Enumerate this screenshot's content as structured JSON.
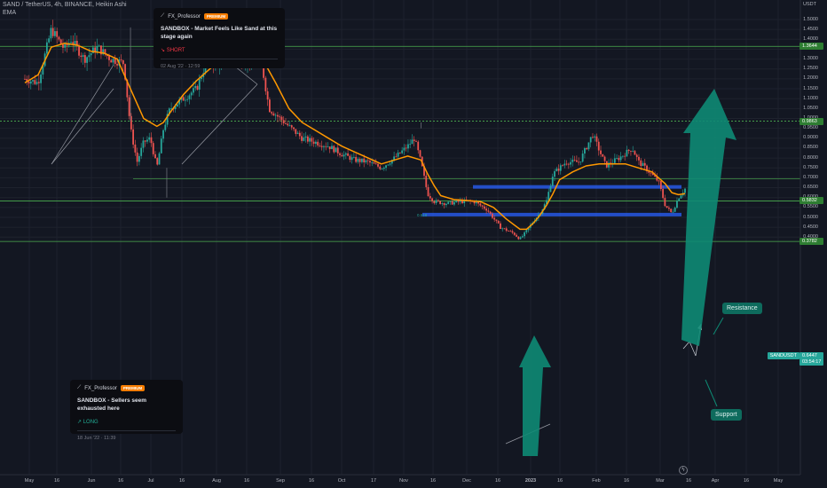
{
  "header": {
    "symbol_line": "SAND / TetherUS, 4h, BINANCE, Heikin Ashi",
    "indicator": "EMA"
  },
  "price_axis": {
    "currency": "USDT"
  },
  "chart_data": {
    "type": "candlestick",
    "symbol": "SAND / TetherUS",
    "interval": "4h",
    "exchange": "BINANCE",
    "candle_style": "Heikin Ashi",
    "y_ticks": [
      "1.5000",
      "1.4500",
      "1.4000",
      "1.3500",
      "1.3000",
      "1.2500",
      "1.2000",
      "1.1500",
      "1.1000",
      "1.0500",
      "1.0000",
      "0.9500",
      "0.9000",
      "0.8500",
      "0.8000",
      "0.7500",
      "0.7000",
      "0.6500",
      "0.6000",
      "0.5500",
      "0.5000",
      "0.4500",
      "0.4000"
    ],
    "x_ticks": [
      "May",
      "16",
      "Jun",
      "16",
      "Jul",
      "16",
      "Aug",
      "16",
      "Sep",
      "16",
      "Oct",
      "17",
      "Nov",
      "16",
      "Dec",
      "16",
      "2023",
      "16",
      "Feb",
      "16",
      "Mar",
      "16",
      "Apr",
      "16",
      "May"
    ],
    "ylim": [
      0.39,
      1.56
    ],
    "price_path": [
      [
        0,
        1.2
      ],
      [
        2,
        1.18
      ],
      [
        4,
        1.45
      ],
      [
        6,
        1.35
      ],
      [
        7,
        1.4
      ],
      [
        9,
        1.3
      ],
      [
        11,
        1.36
      ],
      [
        13,
        1.3
      ],
      [
        15,
        1.28
      ],
      [
        16,
        0.95
      ],
      [
        17,
        0.78
      ],
      [
        18,
        0.88
      ],
      [
        19,
        0.9
      ],
      [
        20,
        0.75
      ],
      [
        21,
        0.95
      ],
      [
        22,
        1.05
      ],
      [
        24,
        1.1
      ],
      [
        26,
        1.15
      ],
      [
        28,
        1.33
      ],
      [
        29,
        1.24
      ],
      [
        31,
        1.4
      ],
      [
        33,
        1.28
      ],
      [
        35,
        1.3
      ],
      [
        36,
        1.25
      ],
      [
        37,
        1.05
      ],
      [
        38,
        1.02
      ],
      [
        40,
        0.96
      ],
      [
        42,
        0.9
      ],
      [
        44,
        0.88
      ],
      [
        46,
        0.86
      ],
      [
        48,
        0.82
      ],
      [
        50,
        0.79
      ],
      [
        52,
        0.78
      ],
      [
        54,
        0.75
      ],
      [
        56,
        0.8
      ],
      [
        58,
        0.86
      ],
      [
        59,
        0.9
      ],
      [
        60,
        0.78
      ],
      [
        61,
        0.62
      ],
      [
        62,
        0.58
      ],
      [
        64,
        0.57
      ],
      [
        66,
        0.58
      ],
      [
        68,
        0.58
      ],
      [
        70,
        0.54
      ],
      [
        72,
        0.45
      ],
      [
        74,
        0.42
      ],
      [
        75,
        0.39
      ],
      [
        76,
        0.43
      ],
      [
        77,
        0.48
      ],
      [
        78,
        0.52
      ],
      [
        79,
        0.58
      ],
      [
        80,
        0.72
      ],
      [
        82,
        0.78
      ],
      [
        84,
        0.78
      ],
      [
        86,
        0.92
      ],
      [
        88,
        0.76
      ],
      [
        90,
        0.8
      ],
      [
        92,
        0.85
      ],
      [
        93,
        0.78
      ],
      [
        94,
        0.75
      ],
      [
        96,
        0.68
      ],
      [
        97,
        0.56
      ],
      [
        98,
        0.52
      ],
      [
        99,
        0.6
      ],
      [
        100,
        0.6447
      ]
    ],
    "ema_path": [
      [
        0,
        1.18
      ],
      [
        2,
        1.22
      ],
      [
        4,
        1.36
      ],
      [
        6,
        1.38
      ],
      [
        8,
        1.37
      ],
      [
        10,
        1.34
      ],
      [
        12,
        1.33
      ],
      [
        14,
        1.3
      ],
      [
        16,
        1.15
      ],
      [
        18,
        1.0
      ],
      [
        20,
        0.96
      ],
      [
        21,
        0.98
      ],
      [
        22,
        1.03
      ],
      [
        24,
        1.12
      ],
      [
        26,
        1.19
      ],
      [
        28,
        1.25
      ],
      [
        30,
        1.3
      ],
      [
        32,
        1.32
      ],
      [
        34,
        1.33
      ],
      [
        36,
        1.3
      ],
      [
        38,
        1.18
      ],
      [
        40,
        1.05
      ],
      [
        42,
        0.98
      ],
      [
        44,
        0.94
      ],
      [
        46,
        0.9
      ],
      [
        48,
        0.86
      ],
      [
        50,
        0.83
      ],
      [
        52,
        0.8
      ],
      [
        54,
        0.77
      ],
      [
        56,
        0.79
      ],
      [
        58,
        0.81
      ],
      [
        60,
        0.79
      ],
      [
        61,
        0.72
      ],
      [
        62,
        0.66
      ],
      [
        63,
        0.61
      ],
      [
        65,
        0.59
      ],
      [
        67,
        0.585
      ],
      [
        69,
        0.58
      ],
      [
        71,
        0.55
      ],
      [
        73,
        0.49
      ],
      [
        75,
        0.44
      ],
      [
        76,
        0.44
      ],
      [
        77,
        0.47
      ],
      [
        78,
        0.51
      ],
      [
        79,
        0.56
      ],
      [
        80,
        0.62
      ],
      [
        81,
        0.69
      ],
      [
        83,
        0.73
      ],
      [
        85,
        0.76
      ],
      [
        87,
        0.77
      ],
      [
        89,
        0.77
      ],
      [
        91,
        0.77
      ],
      [
        93,
        0.75
      ],
      [
        95,
        0.73
      ],
      [
        96,
        0.7
      ],
      [
        97,
        0.67
      ],
      [
        98,
        0.625
      ],
      [
        99,
        0.615
      ],
      [
        100,
        0.62
      ]
    ],
    "horizontal_levels": [
      {
        "value": 1.3644,
        "color": "#4caf50",
        "tag": "1.3644"
      },
      {
        "value": 0.9863,
        "color": "#4caf50",
        "dashed": true,
        "tag": "0.9863"
      },
      {
        "value": 0.6953,
        "color": "#4caf50",
        "thin": true
      },
      {
        "value": 0.5832,
        "color": "#4caf50",
        "tag": "0.5832"
      },
      {
        "value": 0.3782,
        "color": "#4caf50",
        "tag": "0.3782"
      }
    ],
    "zones": [
      {
        "name": "resistance",
        "value": 0.654,
        "color": "#2962ff"
      },
      {
        "name": "support",
        "value": 0.514,
        "color": "#2962ff"
      }
    ],
    "last_price": "0.6447",
    "last_price_symbol": "SANDUSDT",
    "countdown": "03:54:17",
    "annotation_peak": "0.618",
    "colors": {
      "up": "#26a69a",
      "down": "#ef5350",
      "ema": "#ff9800",
      "zone": "#2962ff",
      "level": "#4caf50",
      "arrow": "#0e8a74",
      "background": "#131722"
    }
  },
  "ideas": [
    {
      "author": "FX_Professor",
      "badge": "PREMIUM",
      "title": "SANDBOX - Market Feels Like Sand at this stage again",
      "direction": "SHORT",
      "date": "02 Aug '22 · 12:59",
      "direction_color": "#f23645"
    },
    {
      "author": "FX_Professor",
      "badge": "PREMIUM",
      "title": "SANDBOX - Sellers seem exhausted here",
      "direction": "LONG",
      "date": "18 Jun '22 · 11:39",
      "direction_color": "#22ab94"
    }
  ],
  "callouts": {
    "resistance": "Resistance",
    "support": "Support"
  }
}
